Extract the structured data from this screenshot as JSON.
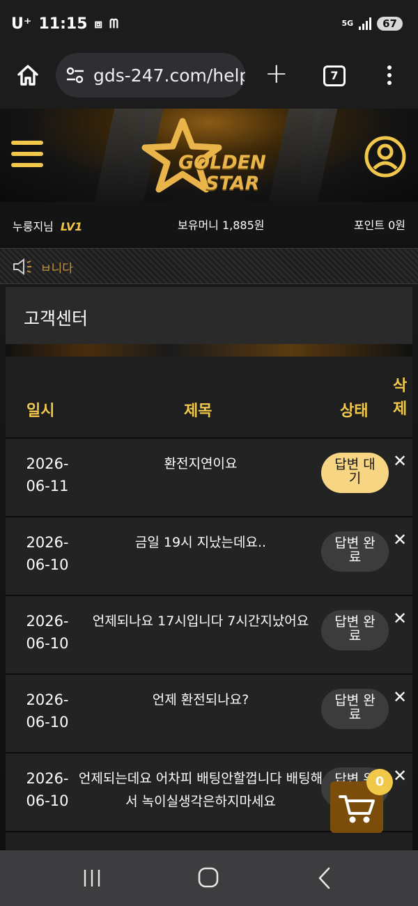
{
  "status_bar": {
    "carrier": "U⁺",
    "time": "11:15",
    "battery": "67",
    "network": "5G"
  },
  "browser": {
    "url": "gds-247.com/help",
    "tab_count": "7"
  },
  "site": {
    "logo_line1": "GOLDEN",
    "logo_line2": "STAR"
  },
  "user_info": {
    "nickname": "누룽지님",
    "level": "LV1",
    "money": "보유머니 1,885원",
    "points": "포인트 0원"
  },
  "notice": {
    "text": "ㅂ니다"
  },
  "section": {
    "title": "고객센터"
  },
  "table": {
    "headers": {
      "date": "일시",
      "title": "제목",
      "status": "상태",
      "delete": "삭제"
    },
    "delete_symbol": "✕",
    "rows": [
      {
        "date_line1": "2026-",
        "date_line2": "06-11",
        "title": "환전지연이요",
        "status": "답변 대기",
        "status_type": "waiting"
      },
      {
        "date_line1": "2026-",
        "date_line2": "06-10",
        "title": "금일 19시 지났는데요..",
        "status": "답변 완료",
        "status_type": "done"
      },
      {
        "date_line1": "2026-",
        "date_line2": "06-10",
        "title": "언제되나요 17시입니다 7시간지났어요",
        "status": "답변 완료",
        "status_type": "done"
      },
      {
        "date_line1": "2026-",
        "date_line2": "06-10",
        "title": "언제 환전되나요?",
        "status": "답변 완료",
        "status_type": "done"
      },
      {
        "date_line1": "2026-",
        "date_line2": "06-10",
        "title": "언제되는데요 어차피 배팅안할껍니다 배팅해서 녹이실생각은하지마세요",
        "status": "답변 완료",
        "status_type": "done"
      }
    ]
  },
  "cart": {
    "count": "0"
  },
  "colors": {
    "accent_gold": "#f2c84b",
    "waiting_pill": "#f7d582",
    "done_pill": "#3c3c3c",
    "cart_brown": "#7b4d0a"
  },
  "icons": [
    "home-icon",
    "site-settings-icon",
    "plus-icon",
    "tab-switcher-icon",
    "more-vert-icon",
    "hamburger-menu-icon",
    "golden-star-logo",
    "user-profile-icon",
    "speaker-icon",
    "close-icon",
    "shopping-cart-icon",
    "recent-apps-icon",
    "nav-home-icon",
    "nav-back-icon"
  ]
}
